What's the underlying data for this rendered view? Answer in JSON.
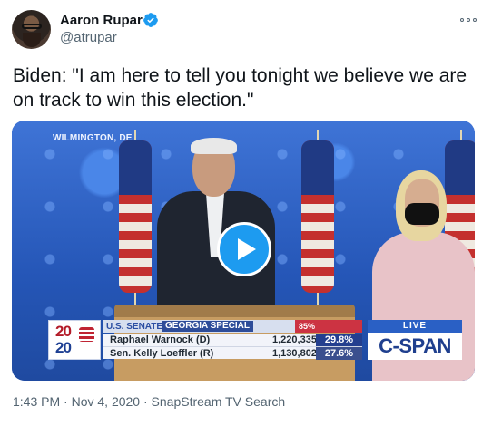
{
  "author": {
    "name": "Aaron Rupar",
    "handle": "@atrupar"
  },
  "tweet": {
    "text": "Biden: \"I am here to tell you tonight we believe we are on track to win this election.\""
  },
  "video": {
    "location": "WILMINGTON, DE",
    "chyron": {
      "logo_top": "20",
      "logo_bottom": "20",
      "race_category": "U.S. SENATE",
      "race_name": "GEORGIA SPECIAL",
      "reporting": "85% REPORTING",
      "live": "LIVE",
      "network": "C-SPAN",
      "candidates": [
        {
          "name": "Raphael Warnock (D)",
          "votes": "1,220,335",
          "pct": "29.8%"
        },
        {
          "name": "Sen. Kelly Loeffler (R)",
          "votes": "1,130,802",
          "pct": "27.6%"
        }
      ]
    }
  },
  "meta": {
    "time": "1:43 PM",
    "date": "Nov 4, 2020",
    "source": "SnapStream TV Search",
    "separator": "·"
  },
  "colors": {
    "verified": "#1d9bf0",
    "play": "#1d9bf0",
    "text_primary": "#0f1419",
    "text_secondary": "#536471"
  },
  "icons": {
    "verified": "verified-badge-icon",
    "more": "more-options-icon",
    "play": "play-icon"
  }
}
